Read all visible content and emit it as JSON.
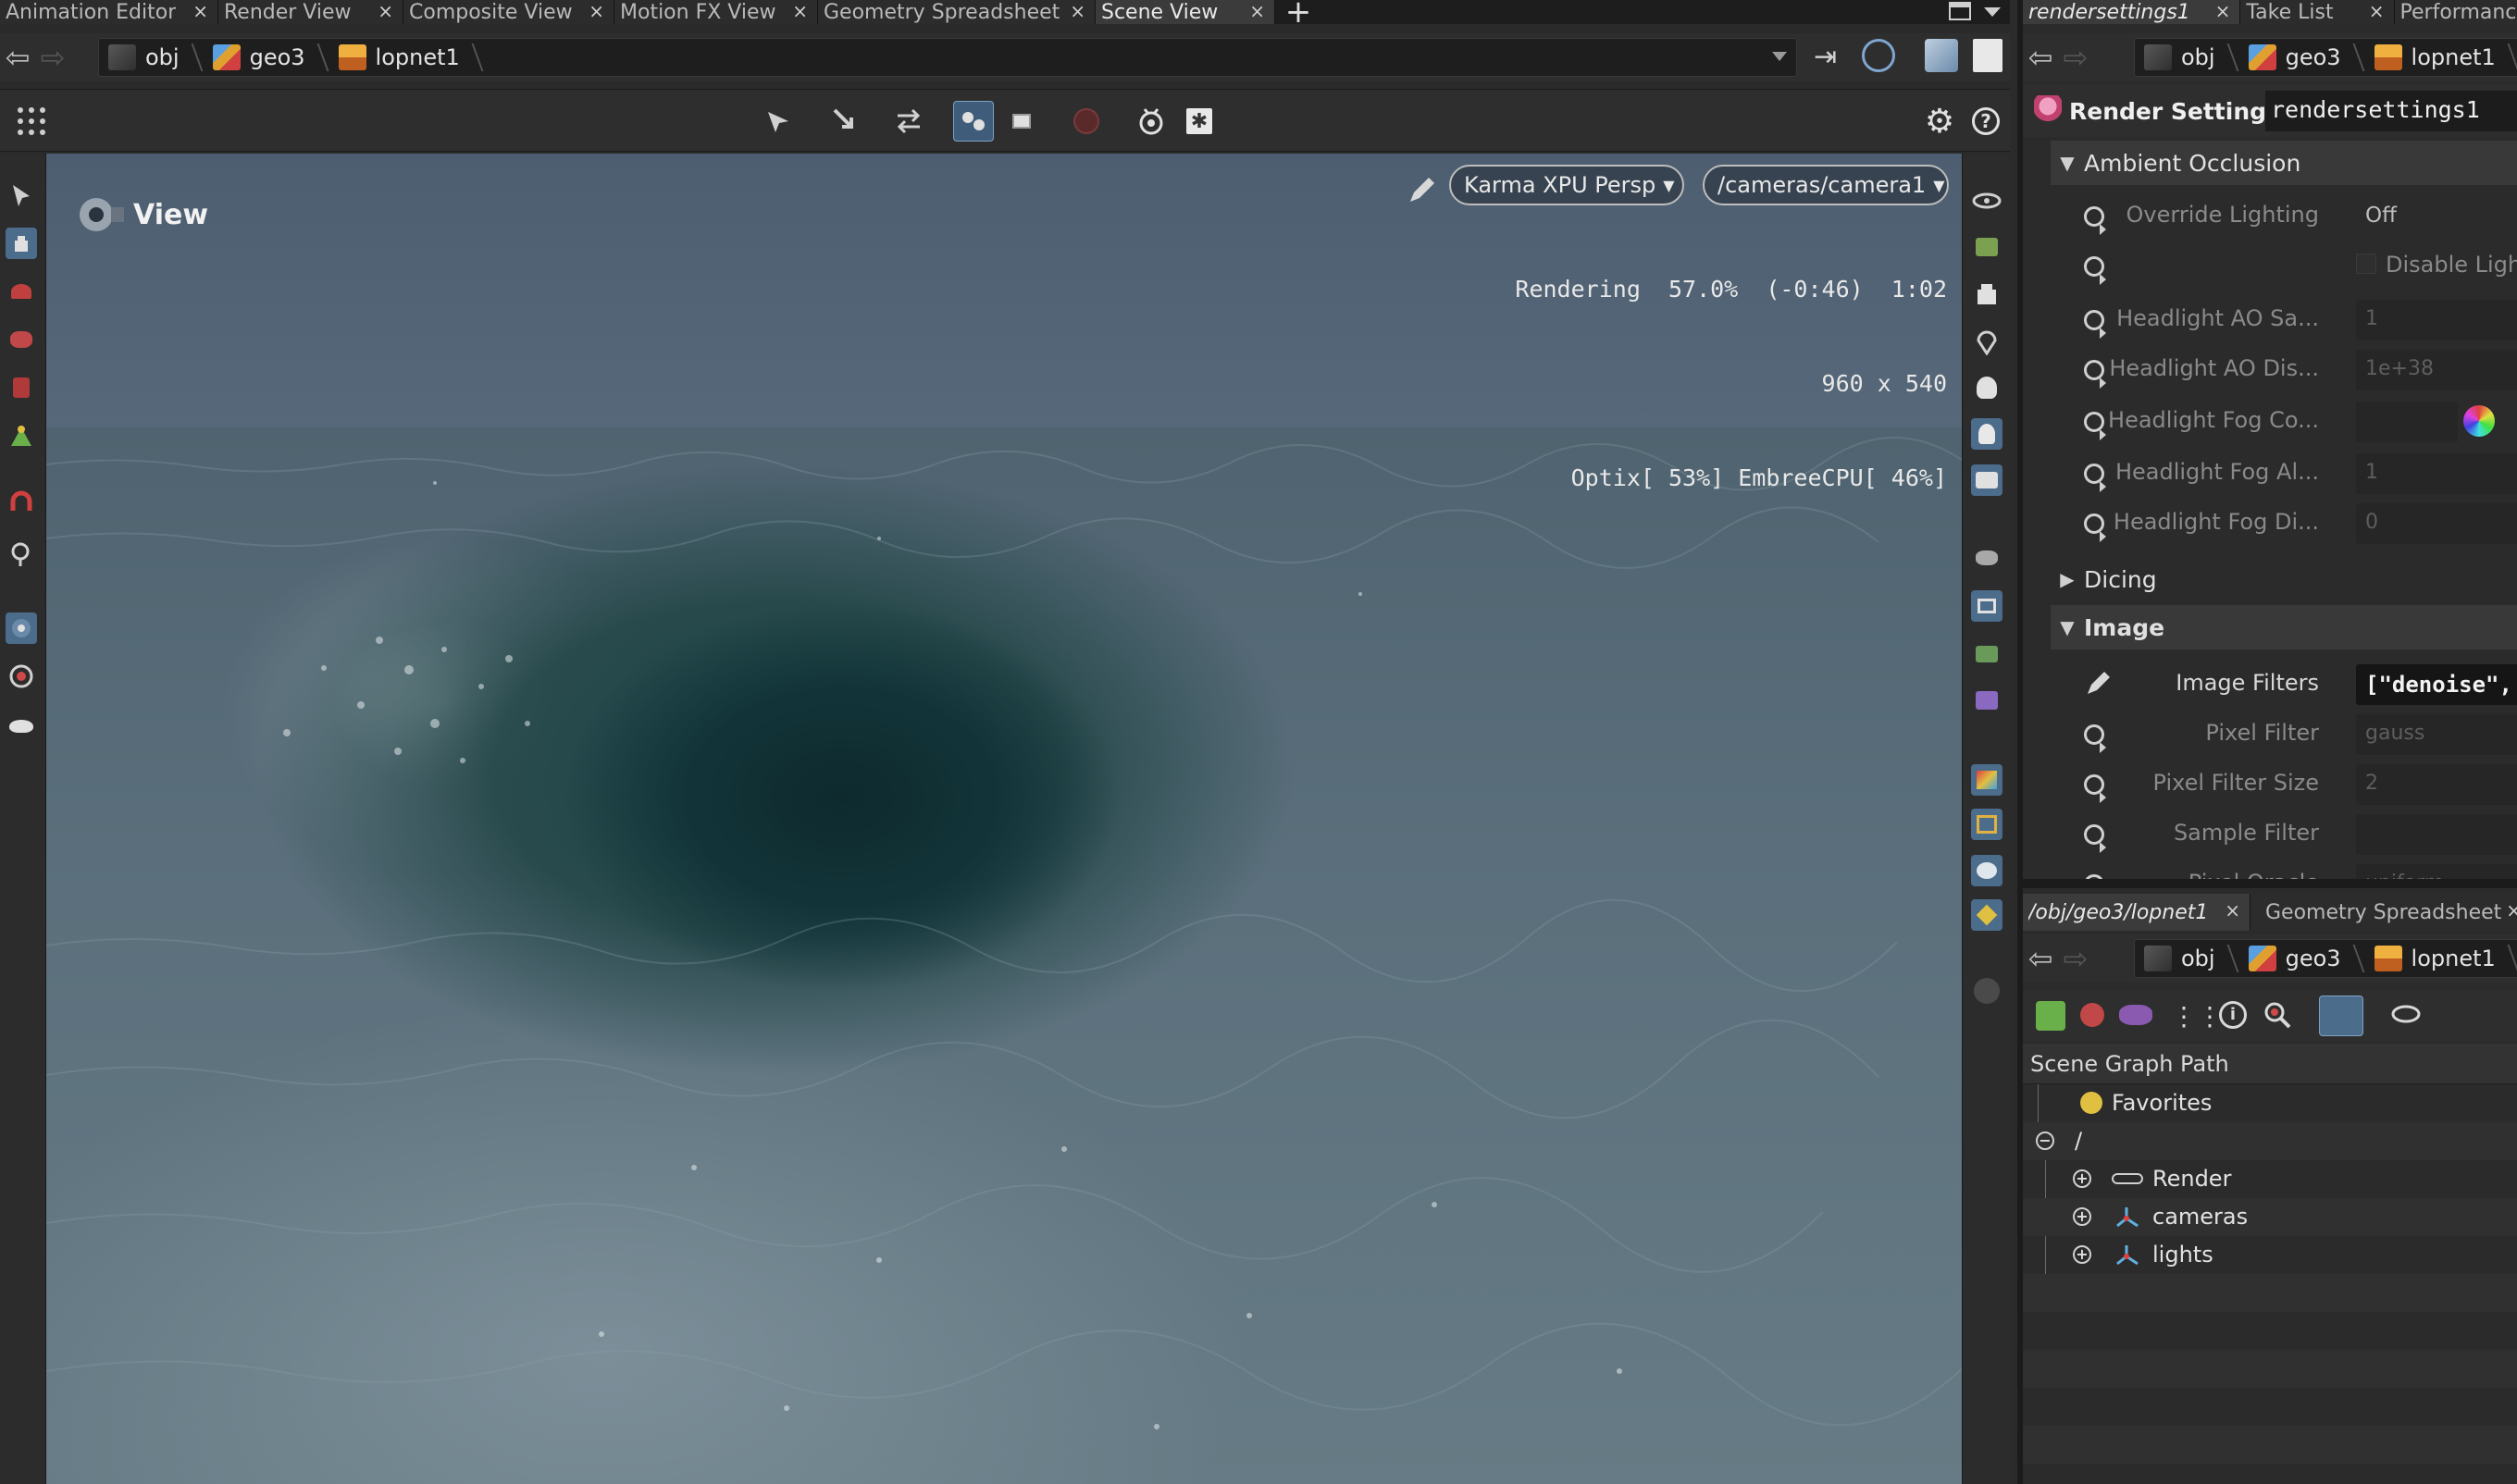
{
  "left_pane": {
    "tabs": [
      {
        "label": "Animation Editor",
        "active": false
      },
      {
        "label": "Render View",
        "active": false
      },
      {
        "label": "Composite View",
        "active": false
      },
      {
        "label": "Motion FX View",
        "active": false
      },
      {
        "label": "Geometry Spreadsheet",
        "active": false
      },
      {
        "label": "Scene View",
        "active": true
      }
    ],
    "add_tab": "+",
    "path": [
      "obj",
      "geo3",
      "lopnet1"
    ],
    "viewport": {
      "label": "View",
      "renderer_menu": "Karma XPU Persp",
      "camera_menu": "/cameras/camera1",
      "status_line1": "Rendering  57.0%  (-0:46)  1:02",
      "status_line2": "960 x 540",
      "status_line3": "Optix[ 53%] EmbreeCPU[ 46%]"
    }
  },
  "right_top": {
    "tabs": [
      {
        "label": "rendersettings1",
        "italic": true
      },
      {
        "label": "Take List",
        "italic": false
      },
      {
        "label": "Performance Monitor",
        "italic": false
      }
    ],
    "path": [
      "obj",
      "geo3",
      "lopnet1"
    ],
    "header": {
      "type_label": "Render Settings",
      "node_name": "rendersettings1"
    },
    "sections": {
      "ambient_occlusion": "Ambient Occlusion",
      "dicing": "Dicing",
      "image": "Image"
    },
    "ao_params": [
      {
        "label": "Override Lighting",
        "value": "Off"
      },
      {
        "label": "",
        "value": "Disable Lighting"
      },
      {
        "label": "Headlight AO Sa...",
        "value": "1"
      },
      {
        "label": "Headlight AO Dis...",
        "value": "1e+38"
      },
      {
        "label": "Headlight Fog Co...",
        "value": ""
      },
      {
        "label": "Headlight Fog Al...",
        "value": "1"
      },
      {
        "label": "Headlight Fog Di...",
        "value": "0"
      }
    ],
    "image_params": [
      {
        "label": "Image Filters",
        "value": "[\"denoise\","
      },
      {
        "label": "Pixel Filter",
        "value": "gauss"
      },
      {
        "label": "Pixel Filter Size",
        "value": "2"
      },
      {
        "label": "Sample Filter",
        "value": ""
      },
      {
        "label": "Pixel Oracle",
        "value": "uniform"
      }
    ]
  },
  "right_bottom": {
    "tabs": [
      {
        "label": "/obj/geo3/lopnet1",
        "italic": true
      },
      {
        "label": "Geometry Spreadsheet",
        "italic": false
      }
    ],
    "path": [
      "obj",
      "geo3",
      "lopnet1"
    ],
    "tree_header": "Scene Graph Path",
    "tree": {
      "favorites": "Favorites",
      "root": "/",
      "children": [
        "Render",
        "cameras",
        "lights"
      ]
    }
  },
  "colors": {
    "accent": "#4c6c8c",
    "sky": "#56687a",
    "water": "#5a6f7b"
  }
}
